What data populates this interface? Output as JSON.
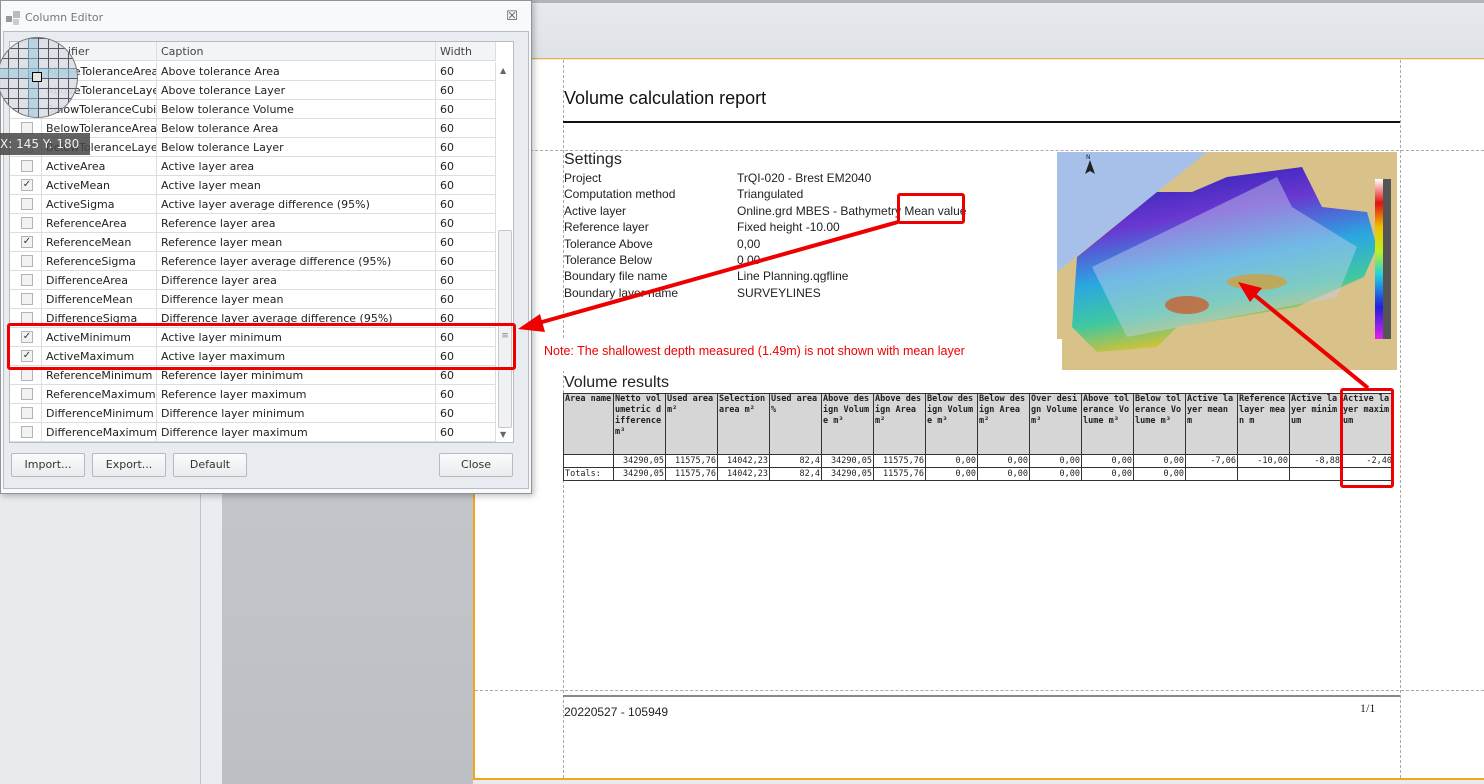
{
  "dialog": {
    "title": "Column Editor",
    "columns": {
      "identifier": "Identifier",
      "caption": "Caption",
      "width": "Width"
    },
    "header_visible_identifier": "ifier",
    "rows": [
      {
        "id": "AboveToleranceArea",
        "caption": "Above tolerance Area",
        "width": "60",
        "checked": false
      },
      {
        "id": "AboveToleranceLayer",
        "caption": "Above tolerance Layer",
        "width": "60",
        "checked": false
      },
      {
        "id": "BelowToleranceCubic",
        "caption": "Below tolerance Volume",
        "width": "60",
        "checked": false
      },
      {
        "id": "BelowToleranceArea",
        "caption": "Below tolerance Area",
        "width": "60",
        "checked": false
      },
      {
        "id": "BelowToleranceLayer",
        "caption": "Below tolerance Layer",
        "width": "60",
        "checked": false
      },
      {
        "id": "ActiveArea",
        "caption": "Active layer area",
        "width": "60",
        "checked": false
      },
      {
        "id": "ActiveMean",
        "caption": "Active layer mean",
        "width": "60",
        "checked": true
      },
      {
        "id": "ActiveSigma",
        "caption": "Active layer average difference (95%)",
        "width": "60",
        "checked": false
      },
      {
        "id": "ReferenceArea",
        "caption": "Reference layer area",
        "width": "60",
        "checked": false
      },
      {
        "id": "ReferenceMean",
        "caption": "Reference layer mean",
        "width": "60",
        "checked": true
      },
      {
        "id": "ReferenceSigma",
        "caption": "Reference layer average difference (95%)",
        "width": "60",
        "checked": false
      },
      {
        "id": "DifferenceArea",
        "caption": "Difference layer area",
        "width": "60",
        "checked": false
      },
      {
        "id": "DifferenceMean",
        "caption": "Difference layer mean",
        "width": "60",
        "checked": false
      },
      {
        "id": "DifferenceSigma",
        "caption": "Difference layer average difference (95%)",
        "width": "60",
        "checked": false
      },
      {
        "id": "ActiveMinimum",
        "caption": "Active layer minimum",
        "width": "60",
        "checked": true
      },
      {
        "id": "ActiveMaximum",
        "caption": "Active layer maximum",
        "width": "60",
        "checked": true
      },
      {
        "id": "ReferenceMinimum",
        "caption": "Reference layer minimum",
        "width": "60",
        "checked": false
      },
      {
        "id": "ReferenceMaximum",
        "caption": "Reference layer maximum",
        "width": "60",
        "checked": false
      },
      {
        "id": "DifferenceMinimum",
        "caption": "Difference layer minimum",
        "width": "60",
        "checked": false
      },
      {
        "id": "DifferenceMaximum",
        "caption": "Difference layer maximum",
        "width": "60",
        "checked": false
      }
    ],
    "buttons": {
      "import": "Import...",
      "export": "Export...",
      "default": "Default",
      "close": "Close"
    },
    "close_glyph": "☒",
    "check_glyph": "✓"
  },
  "magnifier": {
    "coord_label": "X: 145 Y: 180"
  },
  "report": {
    "title": "Volume calculation report",
    "settings_title": "Settings",
    "settings": [
      {
        "label": "Project",
        "value": "TrQI-020 - Brest EM2040"
      },
      {
        "label": "Computation method",
        "value": "Triangulated"
      },
      {
        "label": "Active layer",
        "value": "Online.grd MBES - Bathymetry Mean value"
      },
      {
        "label": "Reference layer",
        "value": "Fixed height -10.00"
      },
      {
        "label": "Tolerance Above",
        "value": "0,00"
      },
      {
        "label": "Tolerance Below",
        "value": "0,00"
      },
      {
        "label": "Boundary file name",
        "value": "Line Planning.qgfline"
      },
      {
        "label": "Boundary layer name",
        "value": "SURVEYLINES"
      }
    ],
    "results_title": "Volume results",
    "table": {
      "headers": [
        "Area name",
        "Netto volumetric difference m³",
        "Used area m²",
        "Selection area m²",
        "Used area %",
        "Above design Volume m³",
        "Above design Area m²",
        "Below design Volume m³",
        "Below design Area m²",
        "Over design Volume m³",
        "Above tolerance Volume m³",
        "Below tolerance Volume m³",
        "Active layer mean m",
        "Reference layer mean m",
        "Active layer minimum",
        "Active layer maximum"
      ],
      "rows": [
        [
          "",
          "34290,05",
          "11575,76",
          "14042,23",
          "82,4",
          "34290,05",
          "11575,76",
          "0,00",
          "0,00",
          "0,00",
          "0,00",
          "0,00",
          "-7,06",
          "-10,00",
          "-8,88",
          "-2,40"
        ],
        [
          "Totals:",
          "34290,05",
          "11575,76",
          "14042,23",
          "82,4",
          "34290,05",
          "11575,76",
          "0,00",
          "0,00",
          "0,00",
          "0,00",
          "0,00",
          "",
          "",
          "",
          ""
        ]
      ]
    },
    "footer": {
      "date": "20220527 - 105949",
      "page": "1/1"
    },
    "map": {
      "north_label": "N"
    }
  },
  "annotation": {
    "note": "Note: The shallowest depth measured (1.49m) is not shown with mean layer",
    "color": "#e00000"
  }
}
